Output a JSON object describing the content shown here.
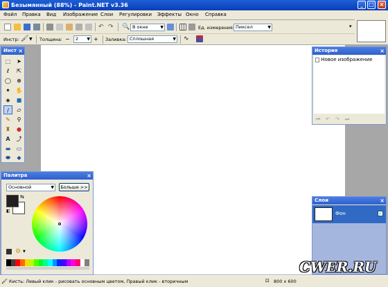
{
  "title": "Безымянный (88%) - Paint.NET v3.36",
  "menu": [
    "Файл",
    "Правка",
    "Вид",
    "Изображение",
    "Слои",
    "Регулировки",
    "Эффекты",
    "Окно",
    "Справка"
  ],
  "toolbar1": {
    "zoom_combo": "В окне",
    "units_label": "Ед. измерения:",
    "units_value": "Пиксел"
  },
  "toolbar2": {
    "tool_label": "Инстр:",
    "width_label": "Толщина:",
    "width_value": "2",
    "fill_label": "Заливка:",
    "fill_value": "Сплошная"
  },
  "tools_panel": {
    "title": "Инст"
  },
  "palette_panel": {
    "title": "Палитра",
    "mode_value": "Основной",
    "more_button": "Больше >>",
    "primary_color": "#202020",
    "secondary_color": "#ffffff"
  },
  "history_panel": {
    "title": "История",
    "items": [
      "Новое изображение"
    ]
  },
  "layers_panel": {
    "title": "Слои",
    "layer_name": "Фон",
    "layer_visible": true
  },
  "status": {
    "hint": "Кисть: Левый клик - рисовать основным цветом, Правый клик - вторичным",
    "size": "800 x 600"
  },
  "watermark": "CWER.RU",
  "palette_colors": [
    "#000000",
    "#404040",
    "#ff0000",
    "#ff6a00",
    "#ffd800",
    "#b6ff00",
    "#4cff00",
    "#00ff21",
    "#00ff90",
    "#00ffff",
    "#0094ff",
    "#0026ff",
    "#4800ff",
    "#b200ff",
    "#ff00dc",
    "#ff006e",
    "#ffffff",
    "#808080"
  ]
}
